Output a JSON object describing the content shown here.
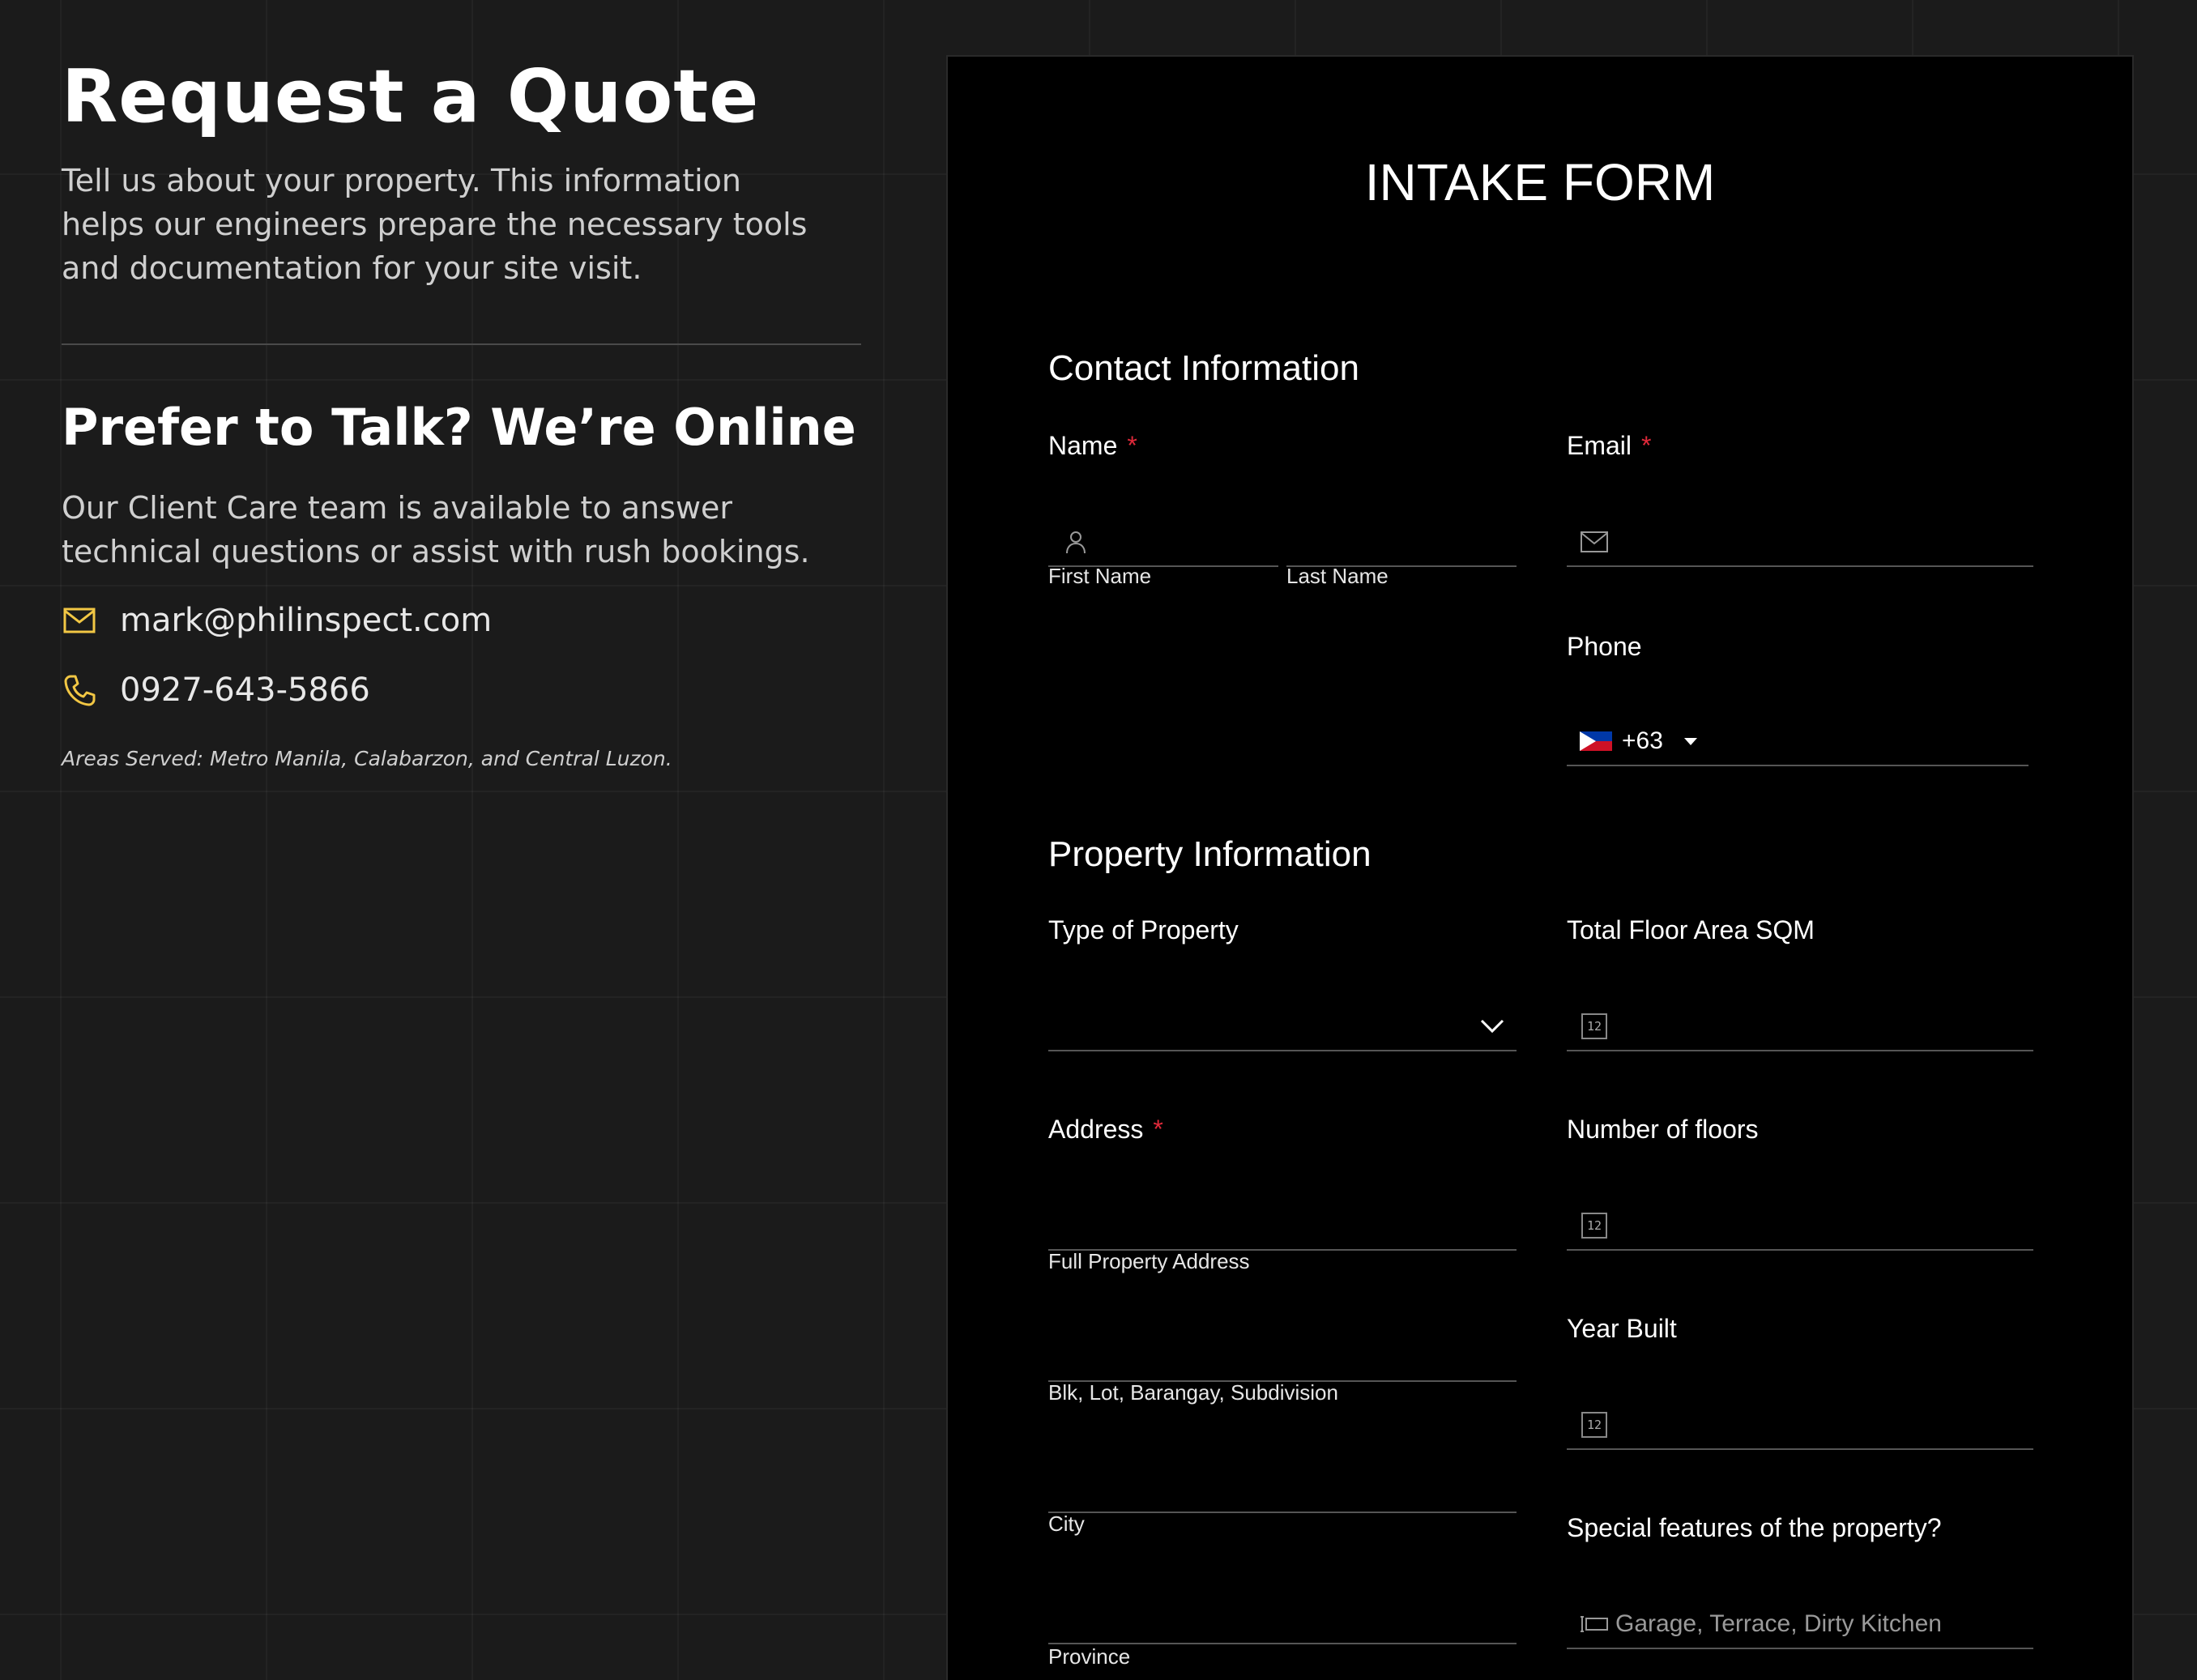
{
  "left": {
    "title": "Request a Quote",
    "intro": "Tell us about your property. This information helps our engineers prepare the necessary tools and documentation for your site visit.",
    "talk_title": "Prefer to Talk? We’re Online",
    "talk_text": "Our Client Care team is available to answer technical questions or assist with rush bookings.",
    "email": "mark@philinspect.com",
    "phone": "0927-643-5866",
    "areas": "Areas Served: Metro Manila, Calabarzon, and Central Luzon.",
    "icon_color": "#f2c744"
  },
  "form": {
    "title": "INTAKE FORM",
    "contact_section": "Contact Information",
    "name_label": "Name",
    "required_mark": "*",
    "first_name": "First Name",
    "last_name": "Last Name",
    "email_label": "Email",
    "phone_label": "Phone",
    "phone_prefix": "+63",
    "property_section": "Property Information",
    "type_label": "Type of Property",
    "floor_area_label": "Total Floor Area SQM",
    "address_label": "Address",
    "address_full": "Full Property Address",
    "address_blk": "Blk, Lot, Barangay, Subdivision",
    "address_city": "City",
    "address_province": "Province",
    "floors_label": "Number of floors",
    "year_label": "Year Built",
    "features_label": "Special features of the property?",
    "features_placeholder": "Garage, Terrace, Dirty Kitchen",
    "number_icon_text": "12"
  }
}
